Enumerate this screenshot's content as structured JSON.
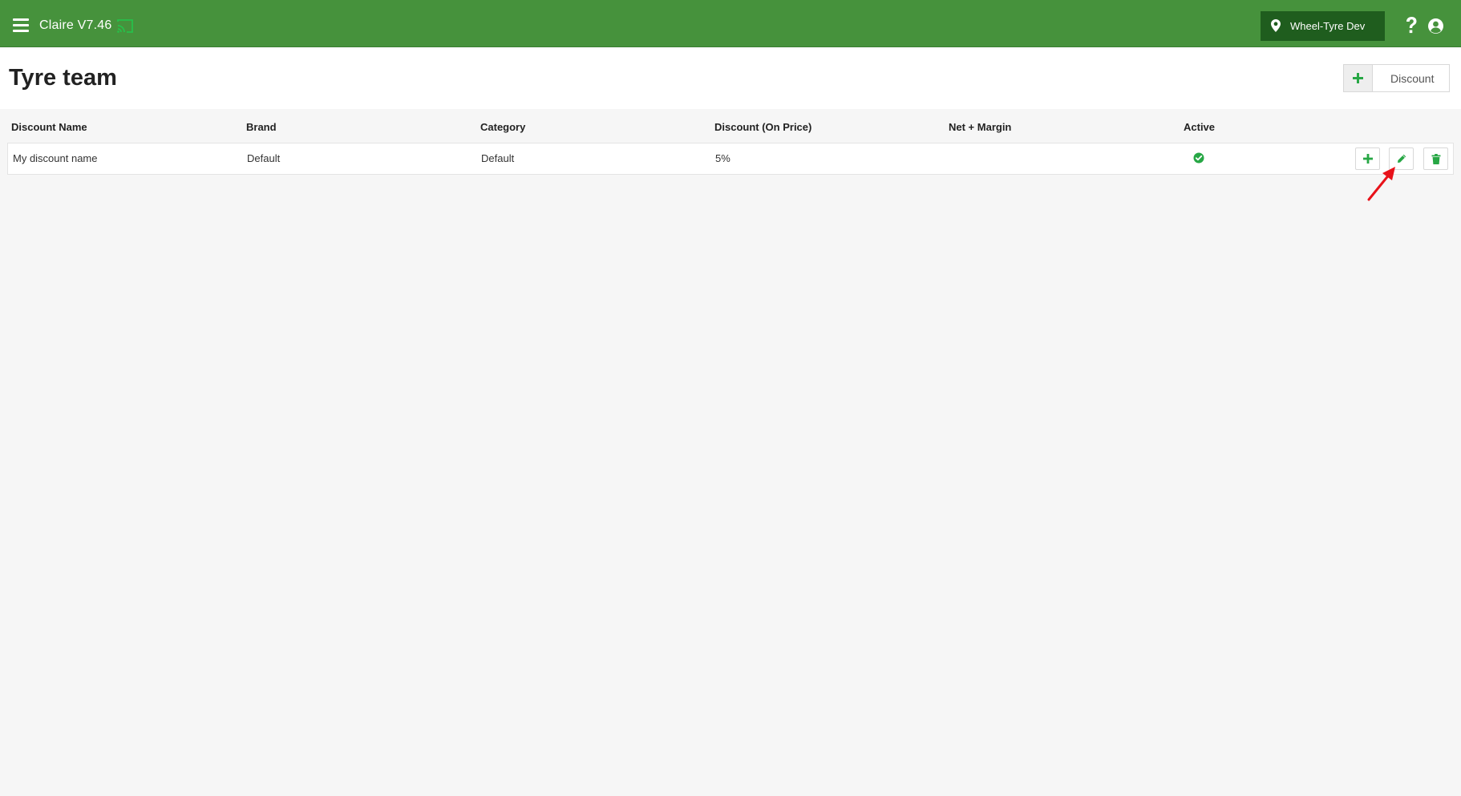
{
  "header": {
    "app_title": "Claire V7.46",
    "location": "Wheel-Tyre Dev",
    "brand_color": "#46923c"
  },
  "page": {
    "title": "Tyre team",
    "add_discount_label": "Discount"
  },
  "table": {
    "columns": [
      "Discount Name",
      "Brand",
      "Category",
      "Discount (On Price)",
      "Net + Margin",
      "Active"
    ],
    "rows": [
      {
        "discount_name": "My discount name",
        "brand": "Default",
        "category": "Default",
        "discount_on_price": "5%",
        "net_margin": "",
        "active": true
      }
    ]
  },
  "colors": {
    "accent_green": "#27a745",
    "active_check": "#27a745",
    "annotation_arrow": "#e8121a"
  },
  "icons": {
    "menu": "hamburger-menu-icon",
    "cast": "cast-icon",
    "location": "map-pin-icon",
    "help": "question-mark-icon",
    "user": "user-circle-icon",
    "add": "plus-icon",
    "edit": "pencil-icon",
    "delete": "trash-icon",
    "active": "check-circle-icon"
  }
}
